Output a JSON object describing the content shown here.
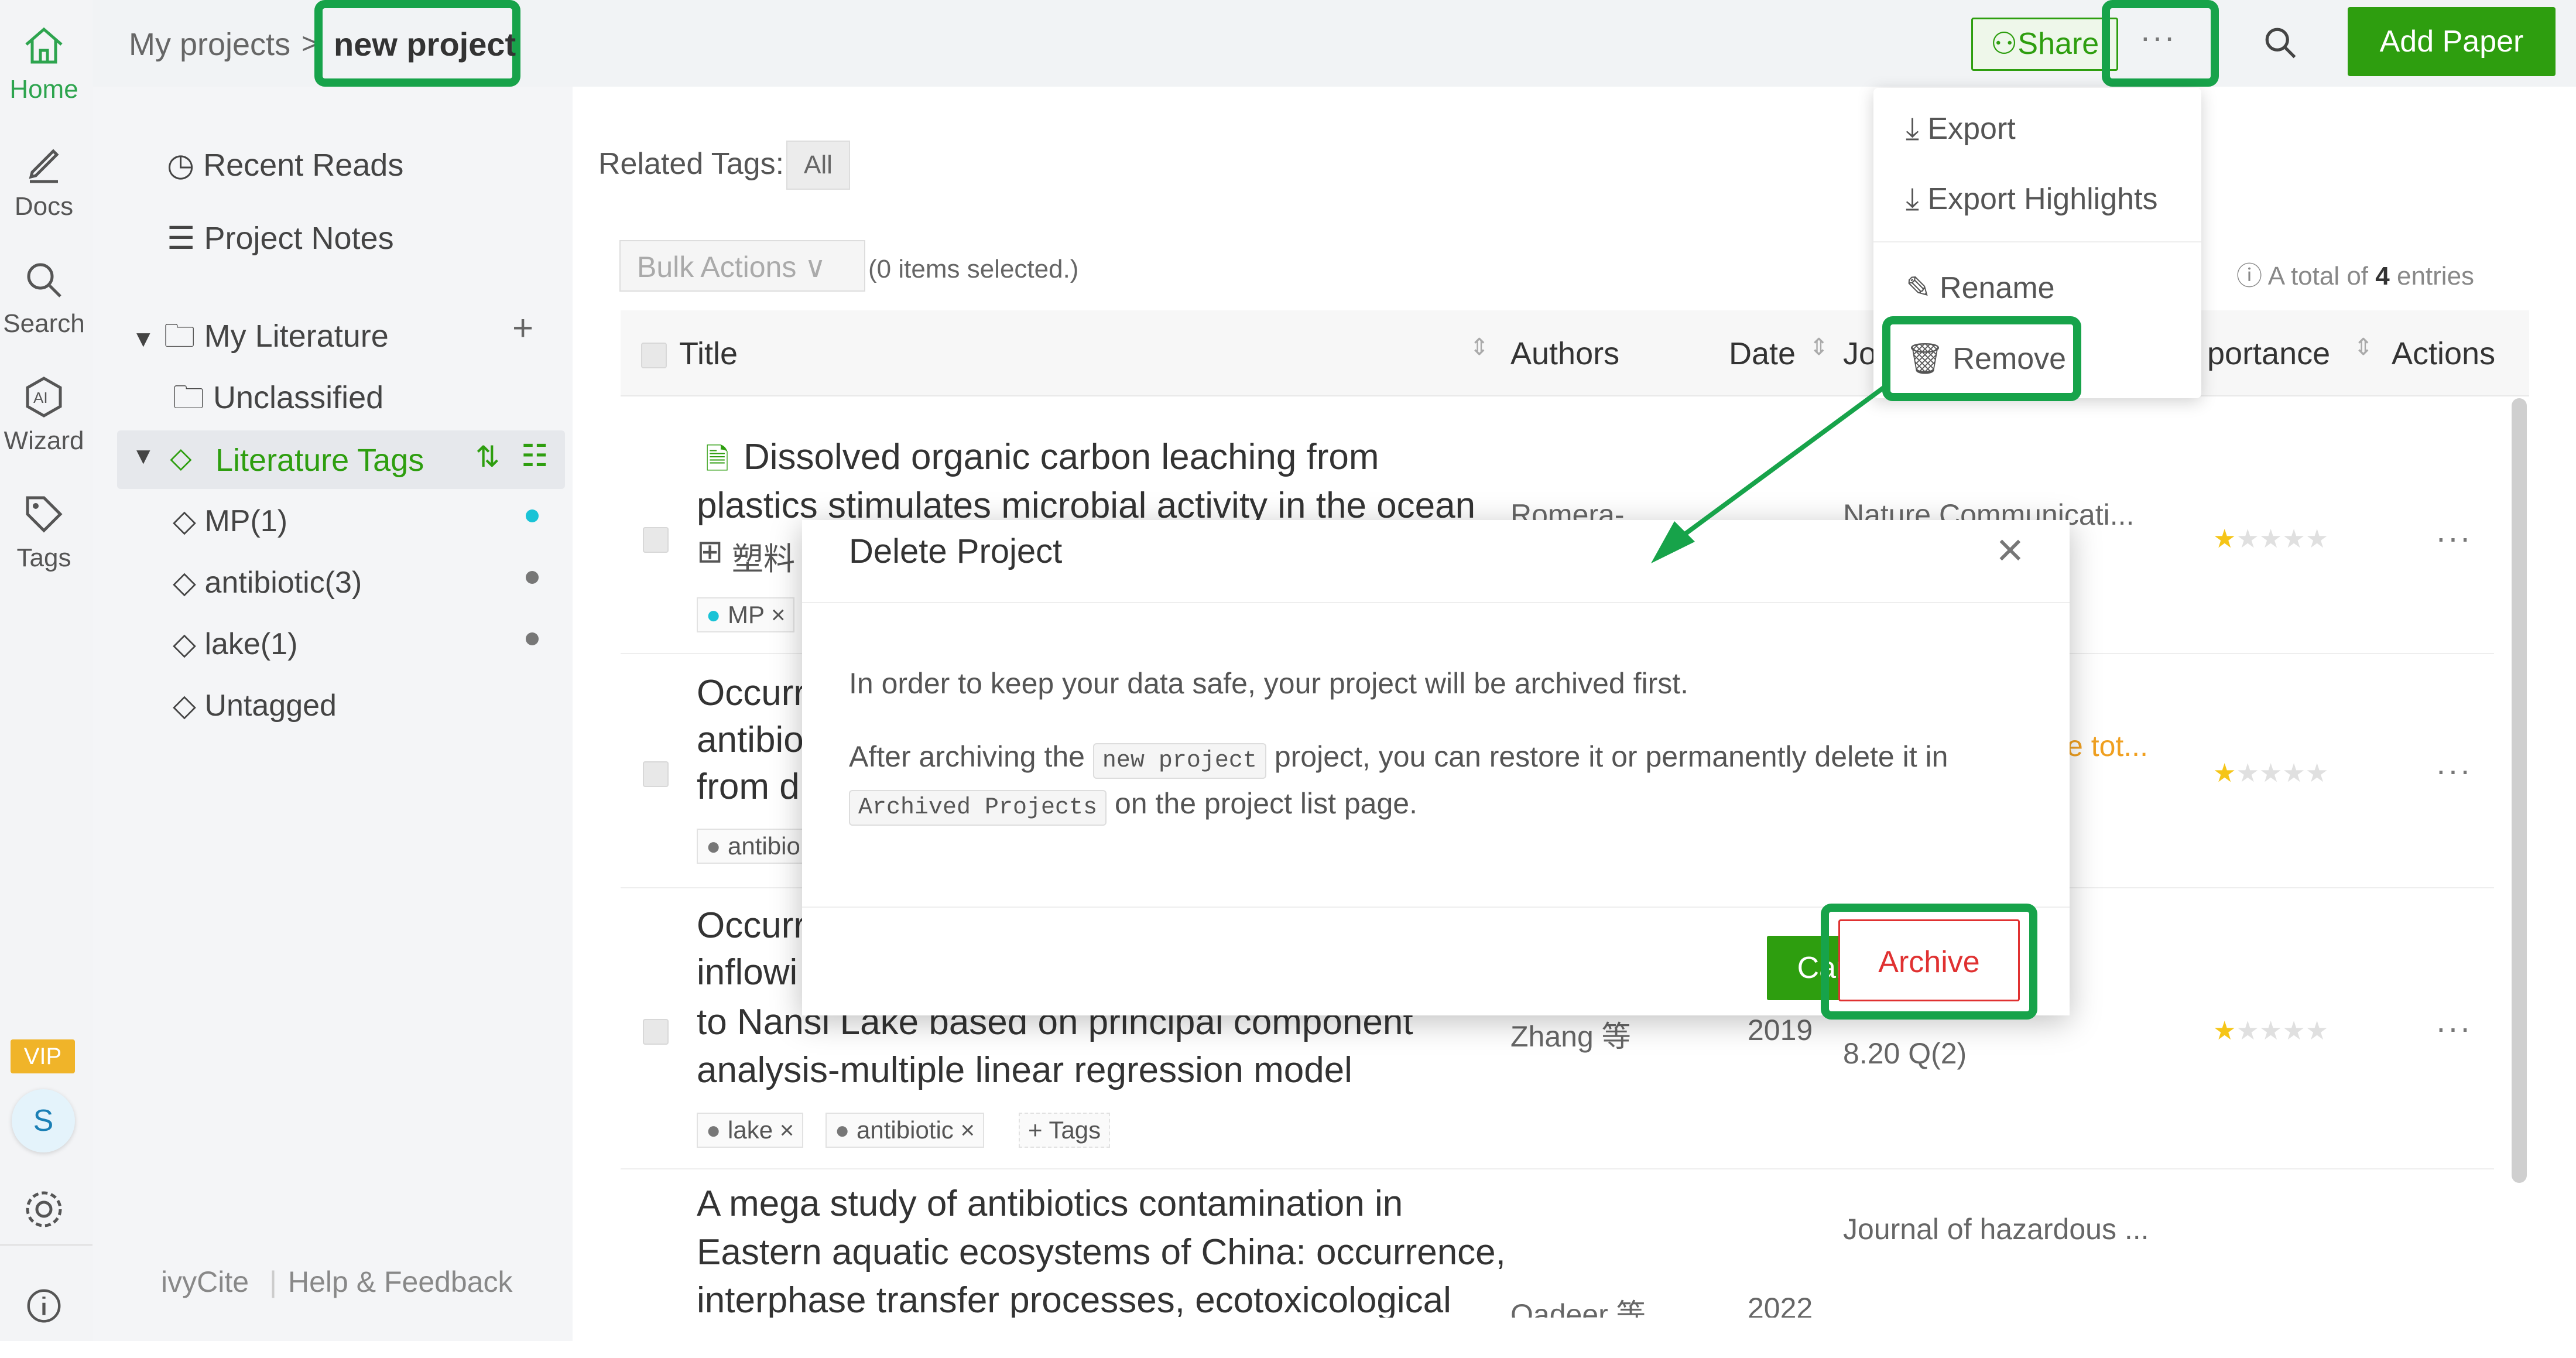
{
  "nav": {
    "home": "Home",
    "docs": "Docs",
    "search": "Search",
    "wizard": "Wizard",
    "tags": "Tags",
    "vip": "VIP",
    "avatar": "S"
  },
  "breadcrumb": {
    "root": "My projects",
    "sep": ">",
    "current": "new project"
  },
  "toolbar": {
    "share": "Share",
    "more": "···",
    "add_paper": "Add Paper"
  },
  "more_menu": {
    "export": "Export",
    "export_highlights": "Export Highlights",
    "rename": "Rename",
    "remove": "Remove"
  },
  "sidebar": {
    "recent_reads": "Recent Reads",
    "project_notes": "Project Notes",
    "my_literature": "My Literature",
    "unclassified": "Unclassified",
    "literature_tags": "Literature Tags",
    "tags": [
      {
        "label": "MP(1)",
        "color": "#19c3d6"
      },
      {
        "label": "antibiotic(3)",
        "color": "#777777"
      },
      {
        "label": "lake(1)",
        "color": "#777777"
      },
      {
        "label": "Untagged",
        "color": ""
      }
    ],
    "footer_brand": "ivyCite",
    "footer_help": "Help & Feedback"
  },
  "filters": {
    "related_tags_label": "Related Tags:",
    "all": "All"
  },
  "bulk": {
    "label": "Bulk Actions",
    "selected": "(0 items selected.)",
    "total_prefix": "A total of",
    "total_count": "4",
    "total_suffix": "entries"
  },
  "table": {
    "columns": {
      "title": "Title",
      "authors": "Authors",
      "date": "Date",
      "journal": "Jo",
      "importance": "portance",
      "actions": "Actions"
    },
    "rows": [
      {
        "title_line1": "Dissolved organic carbon leaching from",
        "title_line2": "plastics stimulates microbial activity in the ocean",
        "title_line3": "塑料",
        "authors": "Romera-",
        "journal": "Nature Communicati...",
        "tags": [
          "MP ×"
        ],
        "stars": 1
      },
      {
        "title_line1": "Occurr",
        "title_line2": "antibio",
        "title_line3": "from d",
        "journal": "e tot...",
        "tags": [
          "antibio"
        ],
        "stars": 1
      },
      {
        "title_line1": "Occurr",
        "title_line2": "inflowi",
        "title_line3": "to Nansi Lake based on principal component",
        "title_line4": "analysis-multiple linear regression model",
        "authors": "Zhang 等",
        "date": "2019",
        "journal": "8.20 Q(2)",
        "tags": [
          "lake ×",
          "antibiotic ×",
          "+ Tags"
        ],
        "stars": 1
      },
      {
        "title_line1": "A mega study of antibiotics contamination in",
        "title_line2": "Eastern aquatic ecosystems of China: occurrence,",
        "title_line3": "interphase transfer processes, ecotoxicological",
        "authors": "Qadeer 等",
        "date": "2022",
        "journal": "Journal of hazardous ..."
      }
    ]
  },
  "dialog": {
    "title": "Delete Project",
    "line1": "In order to keep your data safe, your project will be archived first.",
    "line2_a": "After archiving the",
    "line2_code": "new project",
    "line2_b": "project, you can restore it or permanently delete it in",
    "line3_code": "Archived Projects",
    "line3_b": "on the project list page.",
    "cancel": "Cancel",
    "archive": "Archive"
  },
  "colors": {
    "accent": "#2e9e0f",
    "highlight": "#17a34a",
    "danger": "#e03131"
  }
}
